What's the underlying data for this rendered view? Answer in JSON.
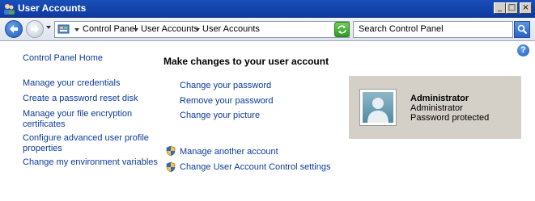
{
  "window": {
    "title": "User Accounts"
  },
  "address_bar": {
    "breadcrumbs": [
      "Control Panel",
      "User Accounts",
      "User Accounts"
    ]
  },
  "search": {
    "placeholder": "Search Control Panel"
  },
  "sidebar": {
    "links": [
      "Control Panel Home",
      "Manage your credentials",
      "Create a password reset disk",
      "Manage your file encryption certificates",
      "Configure advanced user profile properties",
      "Change my environment variables"
    ]
  },
  "main": {
    "heading": "Make changes to your user account",
    "links": [
      "Change your password",
      "Remove your password",
      "Change your picture"
    ],
    "admin_links": [
      "Manage another account",
      "Change User Account Control settings"
    ]
  },
  "account": {
    "name": "Administrator",
    "role": "Administrator",
    "status": "Password protected"
  },
  "colors": {
    "link": "#0b3b9a",
    "titlebar": "#0d3aa0",
    "card": "#d4d0c8"
  },
  "icons": [
    "user-accounts-icon",
    "back-arrow-icon",
    "forward-arrow-icon",
    "control-panel-icon",
    "refresh-icon",
    "search-icon",
    "help-icon",
    "uac-shield-icon",
    "user-avatar-icon"
  ]
}
